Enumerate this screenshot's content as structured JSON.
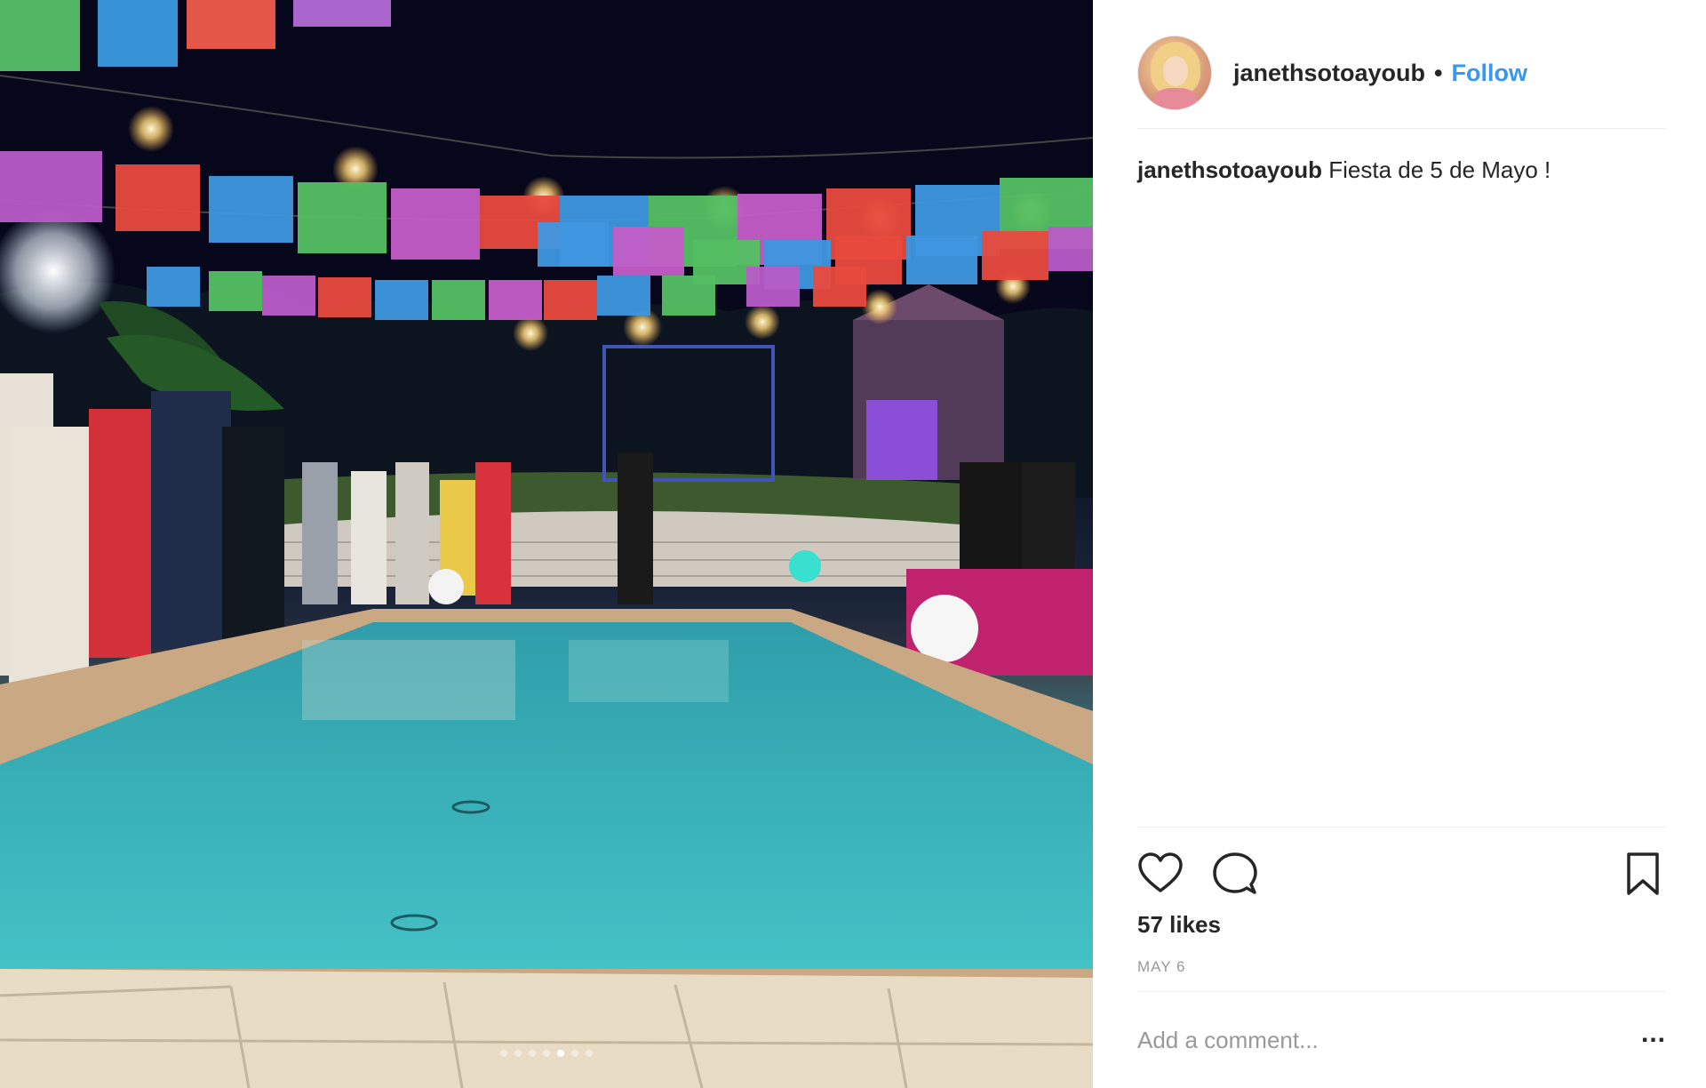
{
  "post": {
    "photo_description_icon": "photo-icon",
    "carousel": {
      "count": 7,
      "active_index": 4
    }
  },
  "header": {
    "username": "janethsotoayoub",
    "separator": "•",
    "follow_label": "Follow"
  },
  "caption": {
    "username": "janethsotoayoub",
    "text": "Fiesta de 5 de Mayo !"
  },
  "actions": {
    "like_icon": "heart-icon",
    "comment_icon": "comment-icon",
    "save_icon": "bookmark-icon"
  },
  "likes_label": "57 likes",
  "date": "MAY 6",
  "comment": {
    "placeholder": "Add a comment...",
    "more_label": "..."
  },
  "colors": {
    "follow": "#3897f0",
    "text": "#262626",
    "muted": "#999999",
    "divider": "#efefef"
  }
}
